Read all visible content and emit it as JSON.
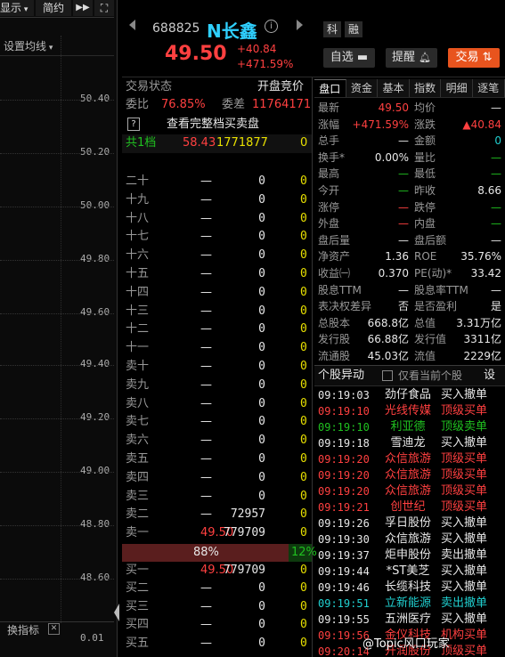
{
  "left": {
    "display_label": "显示",
    "yueyue_label": "简约",
    "settings_label": "设置均线",
    "y_ticks": [
      "50.40",
      "50.20",
      "50.00",
      "49.80",
      "49.60",
      "49.40",
      "49.20",
      "49.00",
      "48.80",
      "48.60",
      "0.01"
    ],
    "indicator_label": "换指标",
    "close_glyph": "✕"
  },
  "header": {
    "code": "688825",
    "name": "N长鑫",
    "kind_short": "科",
    "margin_short": "融",
    "price": "49.50",
    "change": "+40.84",
    "change_pct": "+471.59%",
    "self_select_label": "自选",
    "remind_label": "提醒",
    "trade_label": "交易"
  },
  "tabs": [
    "盘口",
    "资金",
    "基本",
    "指数",
    "明细",
    "逐笔"
  ],
  "book": {
    "status_label": "交易状态",
    "status_value": "开盘竞价",
    "weibi_label": "委比",
    "weibi_value": "76.85%",
    "weicha_label": "委差",
    "weicha_value": "11764171",
    "full_book_label": "查看完整档买卖盘",
    "first_label": "共1档",
    "first_price": "58.43",
    "first_volume": "1771877",
    "first_count": "0",
    "sell_rows": [
      {
        "label": "二十",
        "price": "—",
        "vol": "0",
        "cnt": "0"
      },
      {
        "label": "十九",
        "price": "—",
        "vol": "0",
        "cnt": "0"
      },
      {
        "label": "十八",
        "price": "—",
        "vol": "0",
        "cnt": "0"
      },
      {
        "label": "十七",
        "price": "—",
        "vol": "0",
        "cnt": "0"
      },
      {
        "label": "十六",
        "price": "—",
        "vol": "0",
        "cnt": "0"
      },
      {
        "label": "十五",
        "price": "—",
        "vol": "0",
        "cnt": "0"
      },
      {
        "label": "十四",
        "price": "—",
        "vol": "0",
        "cnt": "0"
      },
      {
        "label": "十三",
        "price": "—",
        "vol": "0",
        "cnt": "0"
      },
      {
        "label": "十二",
        "price": "—",
        "vol": "0",
        "cnt": "0"
      },
      {
        "label": "十一",
        "price": "—",
        "vol": "0",
        "cnt": "0"
      },
      {
        "label": "卖十",
        "price": "—",
        "vol": "0",
        "cnt": "0"
      },
      {
        "label": "卖九",
        "price": "—",
        "vol": "0",
        "cnt": "0"
      },
      {
        "label": "卖八",
        "price": "—",
        "vol": "0",
        "cnt": "0"
      },
      {
        "label": "卖七",
        "price": "—",
        "vol": "0",
        "cnt": "0"
      },
      {
        "label": "卖六",
        "price": "—",
        "vol": "0",
        "cnt": "0"
      },
      {
        "label": "卖五",
        "price": "—",
        "vol": "0",
        "cnt": "0"
      },
      {
        "label": "卖四",
        "price": "—",
        "vol": "0",
        "cnt": "0"
      },
      {
        "label": "卖三",
        "price": "—",
        "vol": "0",
        "cnt": "0"
      },
      {
        "label": "卖二",
        "price": "—",
        "vol": "72957",
        "cnt": "0"
      },
      {
        "label": "卖一",
        "price": "49.50",
        "vol": "779709",
        "cnt": "0"
      }
    ],
    "ratio_left": "88%",
    "ratio_right": "12%",
    "ratio_fill": 0.88,
    "buy_rows": [
      {
        "label": "买一",
        "price": "49.50",
        "vol": "779709",
        "cnt": "0"
      },
      {
        "label": "买二",
        "price": "—",
        "vol": "0",
        "cnt": "0"
      },
      {
        "label": "买三",
        "price": "—",
        "vol": "0",
        "cnt": "0"
      },
      {
        "label": "买四",
        "price": "—",
        "vol": "0",
        "cnt": "0"
      },
      {
        "label": "买五",
        "price": "—",
        "vol": "0",
        "cnt": "0"
      }
    ]
  },
  "quote": {
    "rows": [
      {
        "l1": "最新",
        "v1": "49.50",
        "c1": "red",
        "l2": "均价",
        "v2": "—",
        "c2": "white"
      },
      {
        "l1": "涨幅",
        "v1": "+471.59%",
        "c1": "red",
        "l2": "涨跌",
        "v2": "▲40.84",
        "c2": "red"
      },
      {
        "l1": "总手",
        "v1": "—",
        "c1": "white",
        "l2": "金额",
        "v2": "0",
        "c2": "cyan"
      },
      {
        "l1": "换手*",
        "v1": "0.00%",
        "c1": "white",
        "l2": "量比",
        "v2": "—",
        "c2": "green"
      },
      {
        "l1": "最高",
        "v1": "—",
        "c1": "green",
        "l2": "最低",
        "v2": "—",
        "c2": "green"
      },
      {
        "l1": "今开",
        "v1": "—",
        "c1": "green",
        "l2": "昨收",
        "v2": "8.66",
        "c2": "white"
      },
      {
        "l1": "涨停",
        "v1": "—",
        "c1": "red",
        "l2": "跌停",
        "v2": "—",
        "c2": "green"
      },
      {
        "l1": "外盘",
        "v1": "—",
        "c1": "red",
        "l2": "内盘",
        "v2": "—",
        "c2": "green"
      },
      {
        "l1": "盘后量",
        "v1": "—",
        "c1": "white",
        "l2": "盘后额",
        "v2": "—",
        "c2": "white"
      },
      {
        "l1": "净资产",
        "v1": "1.36",
        "c1": "white",
        "l2": "ROE",
        "v2": "35.76%",
        "c2": "white"
      },
      {
        "l1": "收益㈠",
        "v1": "0.370",
        "c1": "white",
        "l2": "PE(动)*",
        "v2": "33.42",
        "c2": "white"
      },
      {
        "l1": "股息TTM",
        "v1": "—",
        "c1": "white",
        "l2": "股息率TTM",
        "v2": "—",
        "c2": "white"
      },
      {
        "l1": "表决权差异",
        "v1": "否",
        "c1": "white",
        "l2": "是否盈利",
        "v2": "是",
        "c2": "white"
      },
      {
        "l1": "总股本",
        "v1": "668.8亿",
        "c1": "white",
        "l2": "总值",
        "v2": "3.31万亿",
        "c2": "white"
      },
      {
        "l1": "发行股",
        "v1": "66.88亿",
        "c1": "white",
        "l2": "发行值",
        "v2": "3311亿",
        "c2": "white"
      },
      {
        "l1": "流通股",
        "v1": "45.03亿",
        "c1": "white",
        "l2": "流值",
        "v2": "2229亿",
        "c2": "white"
      }
    ]
  },
  "movers": {
    "title": "个股异动",
    "only_current_label": "仅看当前个股",
    "settings_label": "设",
    "items": [
      {
        "time": "09:19:03",
        "stock": "劲仔食品",
        "action": "买入撤单",
        "color": "white"
      },
      {
        "time": "09:19:10",
        "stock": "光线传媒",
        "action": "顶级买单",
        "color": "red"
      },
      {
        "time": "09:19:10",
        "stock": "利亚德",
        "action": "顶级卖单",
        "color": "green"
      },
      {
        "time": "09:19:18",
        "stock": "雪迪龙",
        "action": "买入撤单",
        "color": "white"
      },
      {
        "time": "09:19:20",
        "stock": "众信旅游",
        "action": "顶级买单",
        "color": "red"
      },
      {
        "time": "09:19:20",
        "stock": "众信旅游",
        "action": "顶级买单",
        "color": "red"
      },
      {
        "time": "09:19:20",
        "stock": "众信旅游",
        "action": "顶级买单",
        "color": "red"
      },
      {
        "time": "09:19:21",
        "stock": "创世纪",
        "action": "顶级买单",
        "color": "red"
      },
      {
        "time": "09:19:26",
        "stock": "孚日股份",
        "action": "买入撤单",
        "color": "white"
      },
      {
        "time": "09:19:30",
        "stock": "众信旅游",
        "action": "买入撤单",
        "color": "white"
      },
      {
        "time": "09:19:37",
        "stock": "炬申股份",
        "action": "卖出撤单",
        "color": "white"
      },
      {
        "time": "09:19:44",
        "stock": "*ST美芝",
        "action": "买入撤单",
        "color": "white"
      },
      {
        "time": "09:19:46",
        "stock": "长缆科技",
        "action": "买入撤单",
        "color": "white"
      },
      {
        "time": "09:19:51",
        "stock": "立新能源",
        "action": "卖出撤单",
        "color": "cyan"
      },
      {
        "time": "09:19:55",
        "stock": "五洲医疗",
        "action": "买入撤单",
        "color": "white"
      },
      {
        "time": "09:19:56",
        "stock": "金仪科技",
        "action": "机构买单",
        "color": "red"
      },
      {
        "time": "09:20:14",
        "stock": "开润股份",
        "action": "顶级买单",
        "color": "red"
      }
    ]
  },
  "watermark": "@Topic风口玩家",
  "colors": {
    "red": "#ff4040",
    "green": "#20c020",
    "cyan": "#20d0d0",
    "accent": "#e8541e",
    "white": "#e8e8e8"
  }
}
